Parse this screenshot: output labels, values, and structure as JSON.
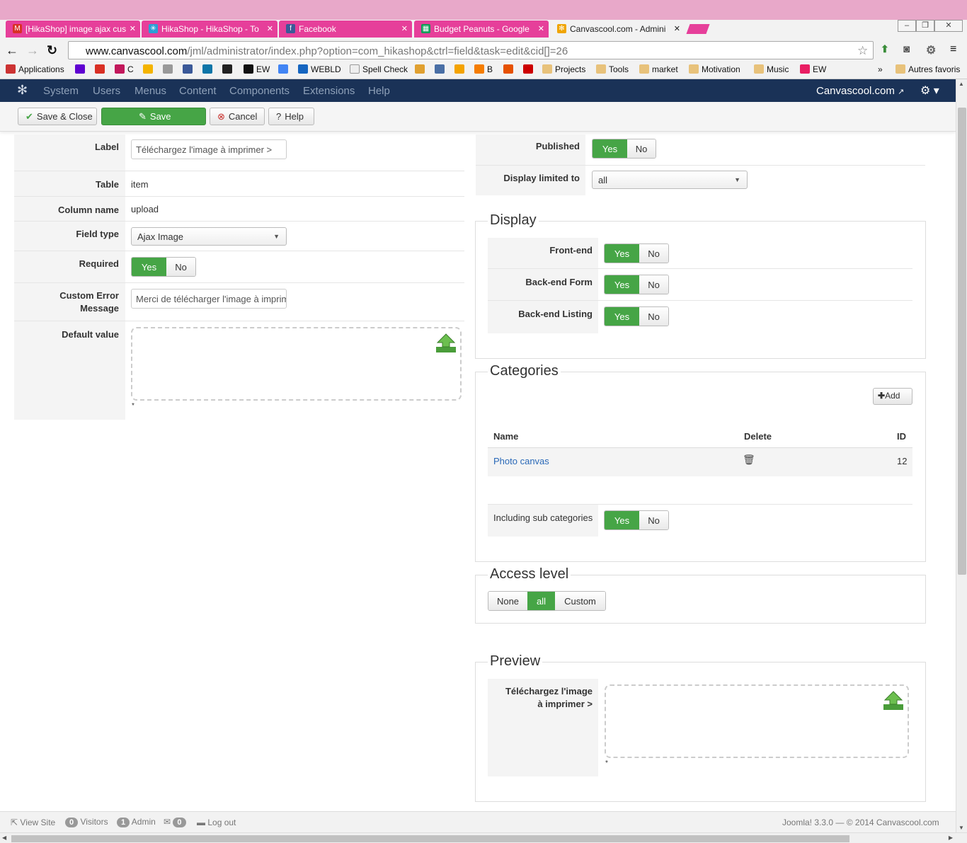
{
  "browser": {
    "tabs": [
      {
        "title": "[HikaShop] image ajax cus",
        "icon": "gmail-icon",
        "color": "#d93025"
      },
      {
        "title": "HikaShop - HikaShop - To",
        "icon": "hikashop-icon",
        "color": "#2a9fd6"
      },
      {
        "title": "Facebook",
        "icon": "facebook-icon",
        "color": "#3b5998"
      },
      {
        "title": "Budget Peanuts - Google",
        "icon": "sheets-icon",
        "color": "#0f9d58"
      },
      {
        "title": "Canvascool.com - Admini",
        "icon": "joomla-icon",
        "color": "#f0a500"
      }
    ],
    "url_domain": "www.canvascool.com",
    "url_path": "/jml/administrator/index.php?option=com_hikashop&ctrl=field&task=edit&cid[]=26",
    "bookmarks": [
      "Applications",
      "C",
      "EW",
      "WEBLD",
      "Spell Check",
      "B",
      "Projects",
      "Tools",
      "market",
      "Motivation",
      "Music",
      "EW"
    ],
    "other_bookmarks": "Autres favoris",
    "more": "»"
  },
  "joomla": {
    "menu": [
      "System",
      "Users",
      "Menus",
      "Content",
      "Components",
      "Extensions",
      "Help"
    ],
    "site_name": "Canvascool.com",
    "toolbar": {
      "save_close": "Save & Close",
      "save": "Save",
      "cancel": "Cancel",
      "help": "Help"
    }
  },
  "form": {
    "label_key": "Label",
    "label_value": "Téléchargez l'image à imprimer >",
    "table_key": "Table",
    "table_value": "item",
    "column_key": "Column name",
    "column_value": "upload",
    "fieldtype_key": "Field type",
    "fieldtype_value": "Ajax Image",
    "required_key": "Required",
    "custom_error_key_1": "Custom Error",
    "custom_error_key_2": "Message",
    "custom_error_value": "Merci de télécharger l'image à imprimer",
    "default_key": "Default value",
    "asterisk": "*"
  },
  "toggle": {
    "yes": "Yes",
    "no": "No"
  },
  "right": {
    "published_key": "Published",
    "display_limited_key": "Display limited to",
    "display_limited_value": "all",
    "display_legend": "Display",
    "frontend_key": "Front-end",
    "backend_form_key": "Back-end Form",
    "backend_listing_key": "Back-end Listing",
    "categories_legend": "Categories",
    "add_button": "Add",
    "col_name": "Name",
    "col_delete": "Delete",
    "col_id": "ID",
    "category_name": "Photo canvas",
    "category_id": "12",
    "including_sub_key": "Including sub categories",
    "access_legend": "Access level",
    "access_none": "None",
    "access_all": "all",
    "access_custom": "Custom",
    "preview_legend": "Preview",
    "preview_key_1": "Téléchargez l'image",
    "preview_key_2": "à imprimer >",
    "preview_asterisk": "*"
  },
  "footer": {
    "view_site": "View Site",
    "visitors_count": "0",
    "visitors": "Visitors",
    "admin_count": "1",
    "admin": "Admin",
    "mail_count": "0",
    "logout": "Log out",
    "version": "Joomla! 3.3.0",
    "copyright": "— © 2014 Canvascool.com"
  },
  "colors": {
    "accent": "#46a546",
    "nav": "#1a3257",
    "link": "#2a69b8"
  }
}
